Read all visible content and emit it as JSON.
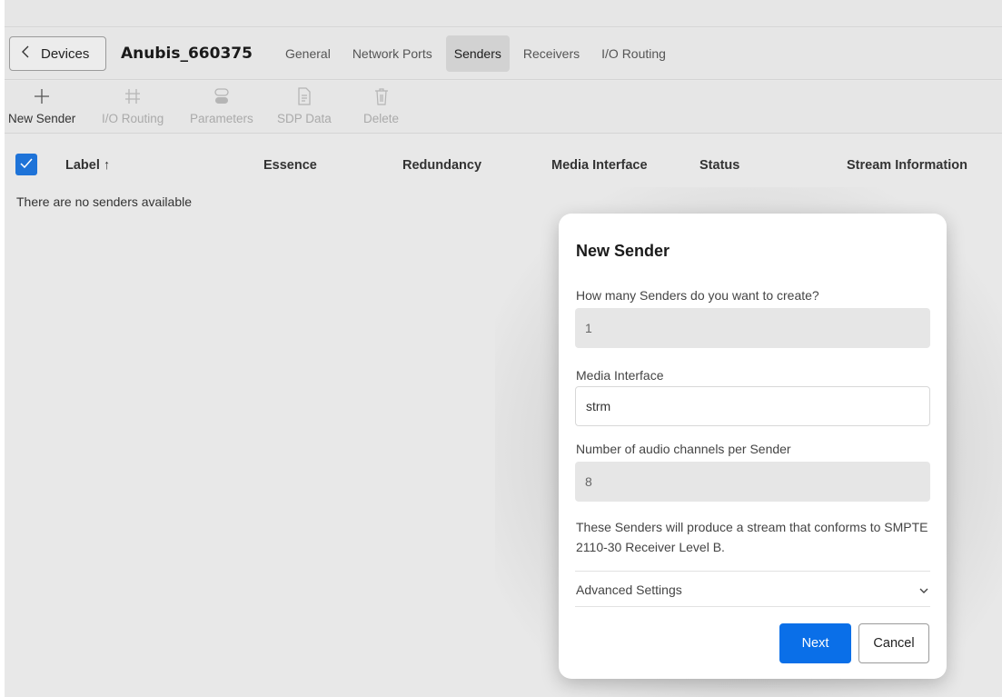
{
  "header": {
    "back_label": "Devices",
    "device_name": "Anubis_660375",
    "tabs": [
      {
        "label": "General",
        "active": false
      },
      {
        "label": "Network Ports",
        "active": false
      },
      {
        "label": "Senders",
        "active": true
      },
      {
        "label": "Receivers",
        "active": false
      },
      {
        "label": "I/O Routing",
        "active": false
      }
    ]
  },
  "toolbar": {
    "items": [
      {
        "label": "New Sender",
        "icon": "plus-icon",
        "enabled": true
      },
      {
        "label": "I/O Routing",
        "icon": "routing-grid-icon",
        "enabled": false
      },
      {
        "label": "Parameters",
        "icon": "toggle-icon",
        "enabled": false
      },
      {
        "label": "SDP Data",
        "icon": "document-icon",
        "enabled": false
      },
      {
        "label": "Delete",
        "icon": "trash-icon",
        "enabled": false
      }
    ]
  },
  "table": {
    "columns": [
      "Label ↑",
      "Essence",
      "Redundancy",
      "Media Interface",
      "Status",
      "Stream Information"
    ],
    "empty_message": "There are no senders available"
  },
  "modal": {
    "title": "New Sender",
    "count_label": "How many Senders do you want to create?",
    "count_value": "1",
    "media_label": "Media Interface",
    "media_value": "strm",
    "channels_label": "Number of audio channels per Sender",
    "channels_value": "8",
    "note": "These Senders will produce a stream that conforms to SMPTE 2110-30 Receiver Level B.",
    "advanced_label": "Advanced Settings",
    "next_label": "Next",
    "cancel_label": "Cancel"
  },
  "colors": {
    "accent": "#0a6fe8",
    "checkbox": "#1e73d8",
    "backdrop": "#e6e6e6"
  }
}
